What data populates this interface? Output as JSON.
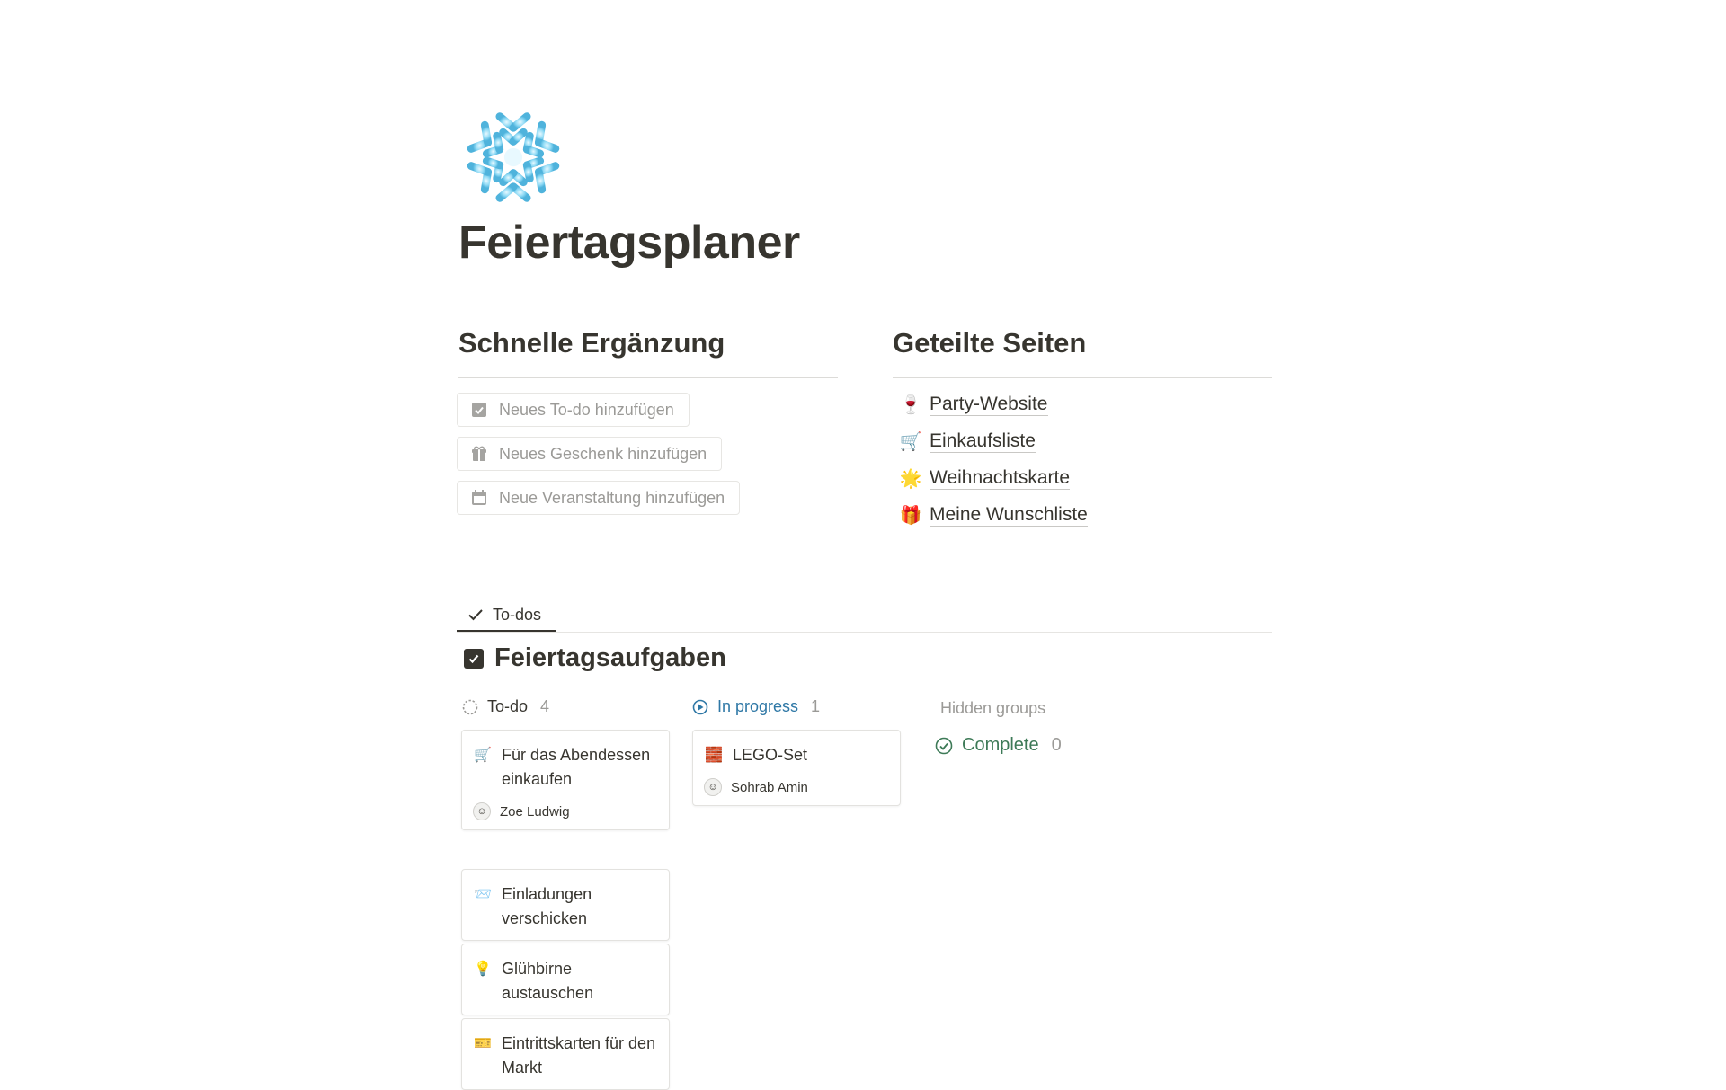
{
  "page": {
    "icon": "snowflake-icon",
    "title": "Feiertagsplaner"
  },
  "quick_add": {
    "heading": "Schnelle Ergänzung",
    "buttons": [
      {
        "label": "Neues To-do hinzufügen",
        "icon": "checkbox-icon"
      },
      {
        "label": "Neues Geschenk hinzufügen",
        "icon": "gift-icon"
      },
      {
        "label": "Neue Veranstaltung hinzufügen",
        "icon": "calendar-icon"
      }
    ]
  },
  "shared_pages": {
    "heading": "Geteilte Seiten",
    "items": [
      {
        "emoji": "🍷",
        "label": "Party-Website"
      },
      {
        "emoji": "🛒",
        "label": "Einkaufsliste"
      },
      {
        "emoji": "🌟",
        "label": "Weihnachtskarte"
      },
      {
        "emoji": "🎁",
        "label": "Meine Wunschliste"
      }
    ]
  },
  "tabs": [
    {
      "label": "To-dos",
      "active": true
    }
  ],
  "database": {
    "title": "Feiertagsaufgaben",
    "groups": {
      "todo": {
        "label": "To-do",
        "count": "4"
      },
      "in_progress": {
        "label": "In progress",
        "count": "1"
      },
      "hidden_label": "Hidden groups",
      "complete": {
        "label": "Complete",
        "count": "0"
      }
    },
    "todo_cards": [
      {
        "emoji": "🛒",
        "title": "Für das Abendessen einkaufen",
        "assignee": "Zoe Ludwig"
      },
      {
        "emoji": "📨",
        "title": "Einladungen verschicken"
      },
      {
        "emoji": "💡",
        "title": "Glühbirne austauschen"
      },
      {
        "emoji": "🎫",
        "title": "Eintrittskarten für den Markt"
      }
    ],
    "in_progress_cards": [
      {
        "emoji": "🧱",
        "title": "LEGO-Set",
        "assignee": "Sohrab Amin"
      }
    ]
  },
  "colors": {
    "text": "#37352f",
    "muted": "#9b9a97",
    "in_progress": "#2f78a6",
    "complete": "#3d7a57",
    "snowflake": "#7fd0ef"
  }
}
